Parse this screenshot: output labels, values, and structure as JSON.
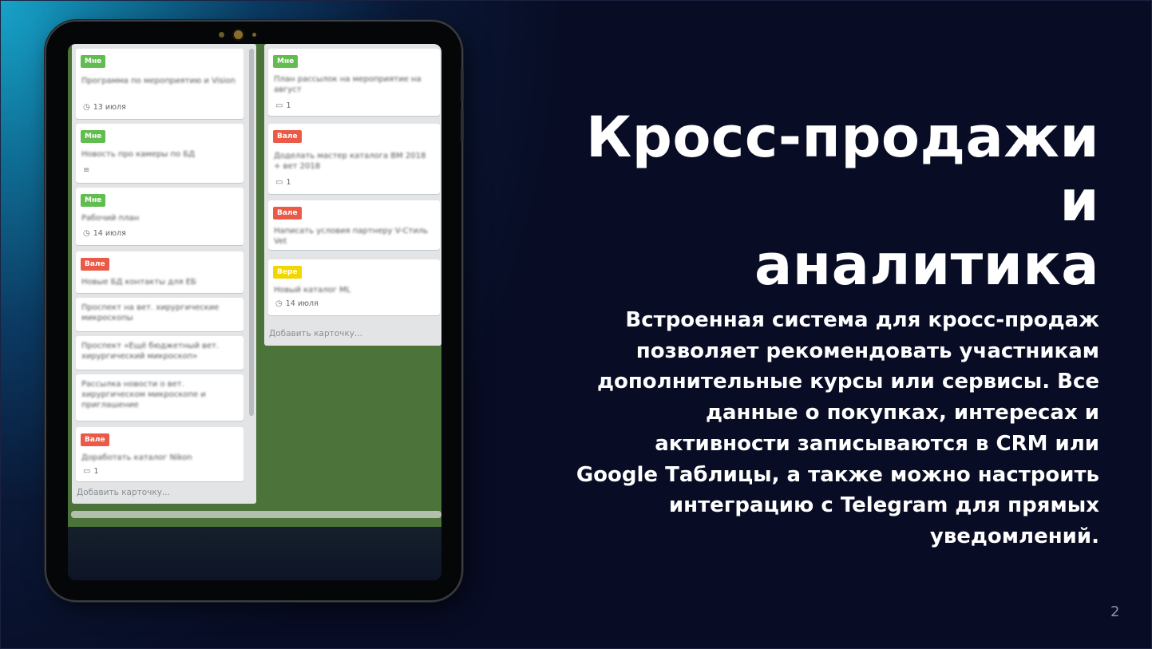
{
  "slide": {
    "title_line1": "Кросс-продажи и",
    "title_line2": "аналитика",
    "body_lines": [
      "Встроенная система для кросс-продаж",
      "позволяет рекомендовать участникам",
      "дополнительные курсы или сервисы. Все",
      "данные о покупках, интересах и",
      "активности записываются в CRM или",
      "Google Таблицы, а также можно настроить",
      "интеграцию с Telegram для прямых",
      "уведомлений."
    ],
    "page_number": "2"
  },
  "board": {
    "add_card_label": "Добавить карточку...",
    "list1": [
      {
        "label": "Мне",
        "label_color": "#61bd4f",
        "text": "Программа по мероприятию и Vision",
        "meta_icon": "clock-icon",
        "meta": "13 июля"
      },
      {
        "label": "Мне",
        "label_color": "#61bd4f",
        "text": "Новость про камеры по БД",
        "meta_icon": "description-icon",
        "meta": ""
      },
      {
        "label": "Мне",
        "label_color": "#61bd4f",
        "text": "Рабочий план",
        "meta_icon": "clock-icon",
        "meta": "14 июля"
      },
      {
        "label": "Вале",
        "label_color": "#eb5a46",
        "text": "Новые БД контакты для ЕБ",
        "meta_icon": "",
        "meta": ""
      },
      {
        "label": "",
        "label_color": "",
        "text": "Проспект на вет. хирургические микроскопы",
        "meta_icon": "",
        "meta": ""
      },
      {
        "label": "",
        "label_color": "",
        "text": "Проспект «Ещё бюджетный вет. хирургический микроскоп»",
        "meta_icon": "",
        "meta": ""
      },
      {
        "label": "",
        "label_color": "",
        "text": "Рассылка новости о вет. хирургическом микроскопе и приглашение",
        "meta_icon": "",
        "meta": ""
      },
      {
        "label": "Вале",
        "label_color": "#eb5a46",
        "text": "Доработать каталог Nikon",
        "meta_icon": "comment-icon",
        "meta": "1"
      }
    ],
    "list2": [
      {
        "label": "Мне",
        "label_color": "#61bd4f",
        "text": "План рассылок на мероприятие на август",
        "meta_icon": "comment-icon",
        "meta": "1"
      },
      {
        "label": "Вале",
        "label_color": "#eb5a46",
        "text": "Доделать мастер каталога ВМ 2018 + вет 2018",
        "meta_icon": "comment-icon",
        "meta": "1"
      },
      {
        "label": "Вале",
        "label_color": "#eb5a46",
        "text": "Написать условия партнеру V-Стиль Vet",
        "meta_icon": "",
        "meta": ""
      },
      {
        "label": "Вере",
        "label_color": "#f2d600",
        "text": "Новый каталог ML",
        "meta_icon": "clock-icon",
        "meta": "14 июля"
      }
    ]
  }
}
